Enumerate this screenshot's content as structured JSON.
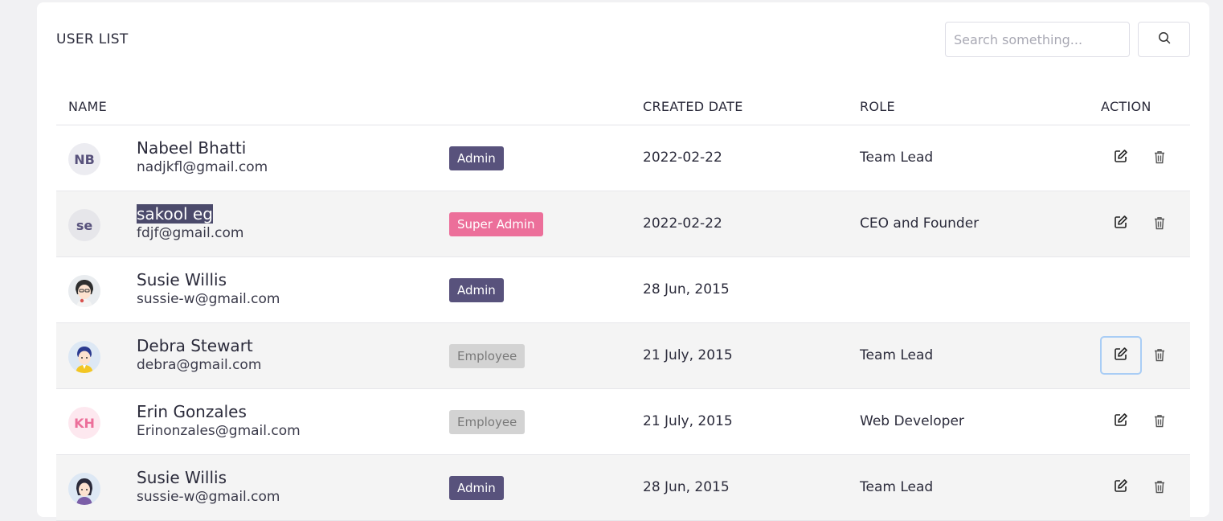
{
  "card": {
    "title": "USER LIST",
    "search_placeholder": "Search something..."
  },
  "table": {
    "headers": {
      "name": "NAME",
      "created": "CREATED DATE",
      "role": "ROLE",
      "action": "ACTION"
    },
    "rows": [
      {
        "initials": "NB",
        "name": "Nabeel Bhatti",
        "email": "nadjkfl@gmail.com",
        "badge": "Admin",
        "date": "2022-02-22",
        "role": "Team Lead"
      },
      {
        "initials": "se",
        "name": "sakool eg",
        "email": "fdjf@gmail.com",
        "badge": "Super Admin",
        "date": "2022-02-22",
        "role": "CEO and Founder"
      },
      {
        "initials": "",
        "name": "Susie Willis",
        "email": "sussie-w@gmail.com",
        "badge": "Admin",
        "date": "28 Jun, 2015",
        "role": ""
      },
      {
        "initials": "",
        "name": "Debra Stewart",
        "email": "debra@gmail.com",
        "badge": "Employee",
        "date": "21 July, 2015",
        "role": "Team Lead"
      },
      {
        "initials": "KH",
        "name": "Erin Gonzales",
        "email": "Erinonzales@gmail.com",
        "badge": "Employee",
        "date": "21 July, 2015",
        "role": "Web Developer"
      },
      {
        "initials": "",
        "name": "Susie Willis",
        "email": "sussie-w@gmail.com",
        "badge": "Admin",
        "date": "28 Jun, 2015",
        "role": "Team Lead"
      }
    ]
  },
  "colors": {
    "admin_badge": "#58527c",
    "super_admin_badge": "#ec6f9a",
    "employee_badge": "#d3d3d3",
    "row_alt": "#f4f4f4",
    "focus_ring": "#a9cdf5"
  },
  "icons": [
    "search-icon",
    "edit-icon",
    "trash-icon",
    "avatar-illustration"
  ]
}
